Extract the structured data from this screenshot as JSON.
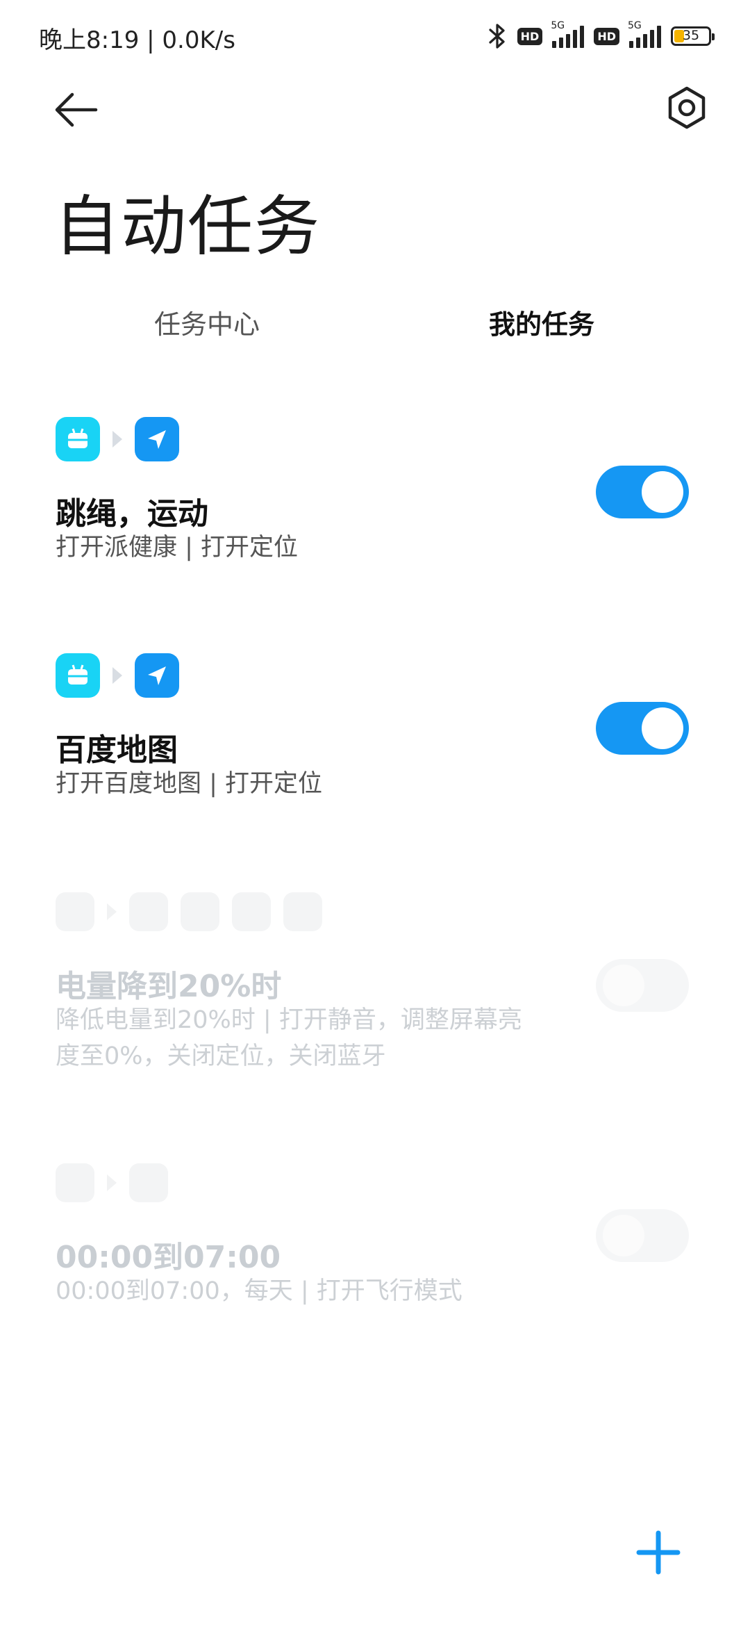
{
  "status_bar": {
    "time": "晚上8:19 | 0.0K/s",
    "sim1": {
      "hd": "HD",
      "network": "5G"
    },
    "sim2": {
      "hd": "HD",
      "network": "5G"
    },
    "battery": "35",
    "icons": [
      "bluetooth-icon",
      "signal-icon",
      "battery-icon"
    ]
  },
  "header": {
    "back_icon": "arrow-left-icon",
    "settings_icon": "gear-icon",
    "title": "自动任务"
  },
  "tabs": [
    {
      "label": "任务中心",
      "active": false
    },
    {
      "label": "我的任务",
      "active": true
    }
  ],
  "tasks": [
    {
      "title": "跳绳，运动",
      "subtitle": "打开派健康 | 打开定位",
      "enabled": true,
      "icons": [
        "app-icon",
        "location-arrow-icon"
      ]
    },
    {
      "title": "百度地图",
      "subtitle": "打开百度地图 | 打开定位",
      "enabled": true,
      "icons": [
        "app-icon",
        "location-arrow-icon"
      ]
    },
    {
      "title": "电量降到20%时",
      "subtitle_line1": "降低电量到20%时 | 打开静音，调整屏幕亮",
      "subtitle_line2": "度至0%，关闭定位，关闭蓝牙",
      "enabled": false
    },
    {
      "title": "00:00到07:00",
      "subtitle": "00:00到07:00，每天 | 打开飞行模式",
      "enabled": false
    }
  ],
  "fab": {
    "icon": "plus-icon"
  },
  "colors": {
    "accent": "#1597f3",
    "app_icon": "#19d3f5",
    "location_icon": "#1597f3"
  }
}
